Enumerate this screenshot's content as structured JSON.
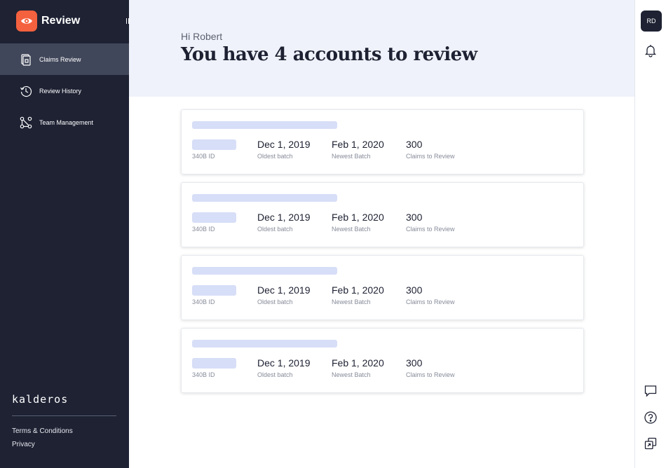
{
  "brand": {
    "name": "Review",
    "accent_color": "#f4613e"
  },
  "sidebar": {
    "items": [
      {
        "label": "Claims Review",
        "icon": "claims-document-icon",
        "active": true
      },
      {
        "label": "Review History",
        "icon": "history-clock-icon",
        "active": false
      },
      {
        "label": "Team Management",
        "icon": "team-network-icon",
        "active": false
      }
    ],
    "company": "kalderos",
    "footer": {
      "terms": "Terms & Conditions",
      "privacy": "Privacy"
    },
    "bg_color": "#1e2233"
  },
  "header": {
    "greeting": "Hi Robert",
    "title": "You have 4 accounts to review"
  },
  "user": {
    "initials": "RD"
  },
  "rail_icons": [
    "bell-icon",
    "chat-icon",
    "help-icon",
    "copy-windows-icon"
  ],
  "labels": {
    "id": "340B ID",
    "oldest": "Oldest batch",
    "newest": "Newest Batch",
    "claims": "Claims to Review"
  },
  "accounts": [
    {
      "oldest": "Dec 1, 2019",
      "newest": "Feb 1, 2020",
      "claims": "300"
    },
    {
      "oldest": "Dec 1, 2019",
      "newest": "Feb 1, 2020",
      "claims": "300"
    },
    {
      "oldest": "Dec 1, 2019",
      "newest": "Feb 1, 2020",
      "claims": "300"
    },
    {
      "oldest": "Dec 1, 2019",
      "newest": "Feb 1, 2020",
      "claims": "300"
    }
  ]
}
